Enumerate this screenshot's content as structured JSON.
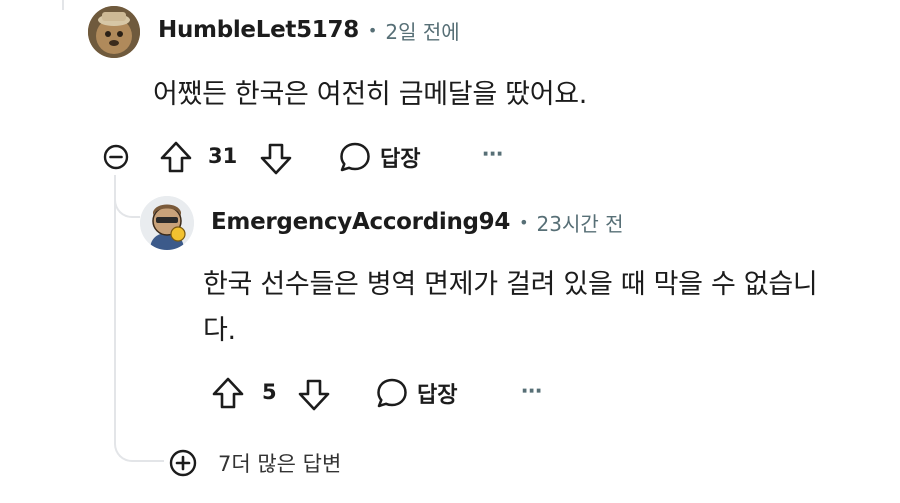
{
  "comment": {
    "username": "HumbleLet5178",
    "separator": "•",
    "time": "2일 전에",
    "text": "어쨌든 한국은 여전히 금메달을 땄어요.",
    "votes": "31",
    "reply_label": "답장",
    "more_label": "⋯"
  },
  "reply": {
    "username": "EmergencyAccording94",
    "separator": "•",
    "time": "23시간 전",
    "text_line1": "한국 선수들은 병역 면제가 걸려 있을 때 막을 수 없습니",
    "text_line2": "다.",
    "votes": "5",
    "reply_label": "답장",
    "more_label": "⋯"
  },
  "more_replies": {
    "label": "7더 많은 답변"
  },
  "icons": {
    "collapse": "collapse-minus-icon",
    "upvote": "upvote-arrow-icon",
    "downvote": "downvote-arrow-icon",
    "reply": "speech-bubble-icon",
    "expand": "expand-plus-icon"
  },
  "colors": {
    "text": "#1c1c1c",
    "meta": "#576f76",
    "thread_line": "#e3e5e8"
  }
}
